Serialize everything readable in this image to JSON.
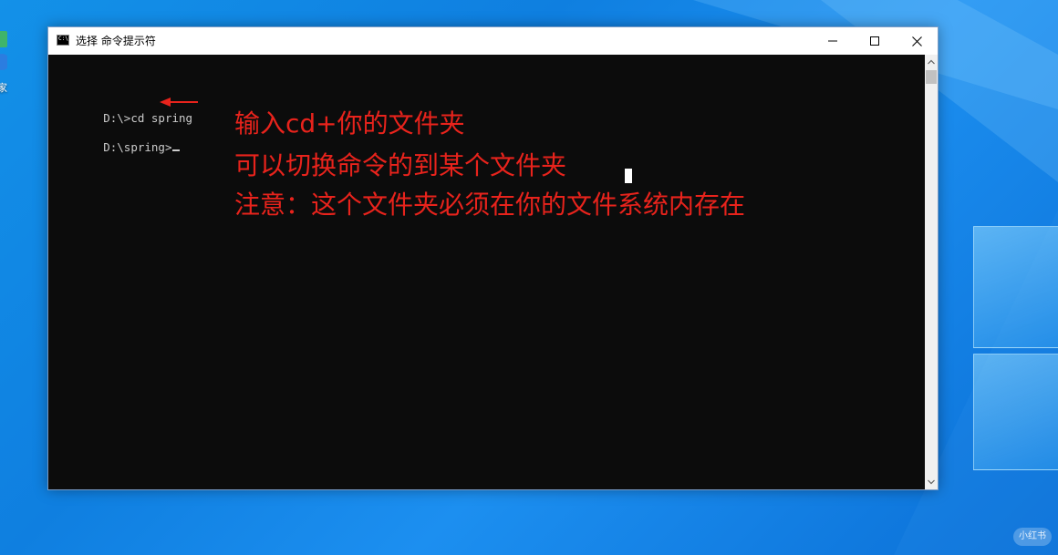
{
  "desktop": {
    "icon_label": "管家",
    "watermark": "小红书"
  },
  "window": {
    "title": "选择 命令提示符",
    "icon_text": "C:\\",
    "buttons": {
      "minimize": "minimize",
      "maximize": "maximize",
      "close": "close"
    }
  },
  "console": {
    "lines": [
      "D:\\>cd spring",
      "D:\\spring>"
    ]
  },
  "annotations": [
    "输入cd+你的文件夹",
    "可以切换命令的到某个文件夹",
    "注意：这个文件夹必须在你的文件系统内存在"
  ],
  "colors": {
    "annotation": "#e8231c",
    "console_bg": "#0c0c0c",
    "console_text": "#cccccc",
    "desktop_bg": "#0f7fe0"
  },
  "icons": {
    "arrow": "arrow-left-icon",
    "scroll_up": "chevron-up-icon",
    "scroll_down": "chevron-down-icon"
  }
}
